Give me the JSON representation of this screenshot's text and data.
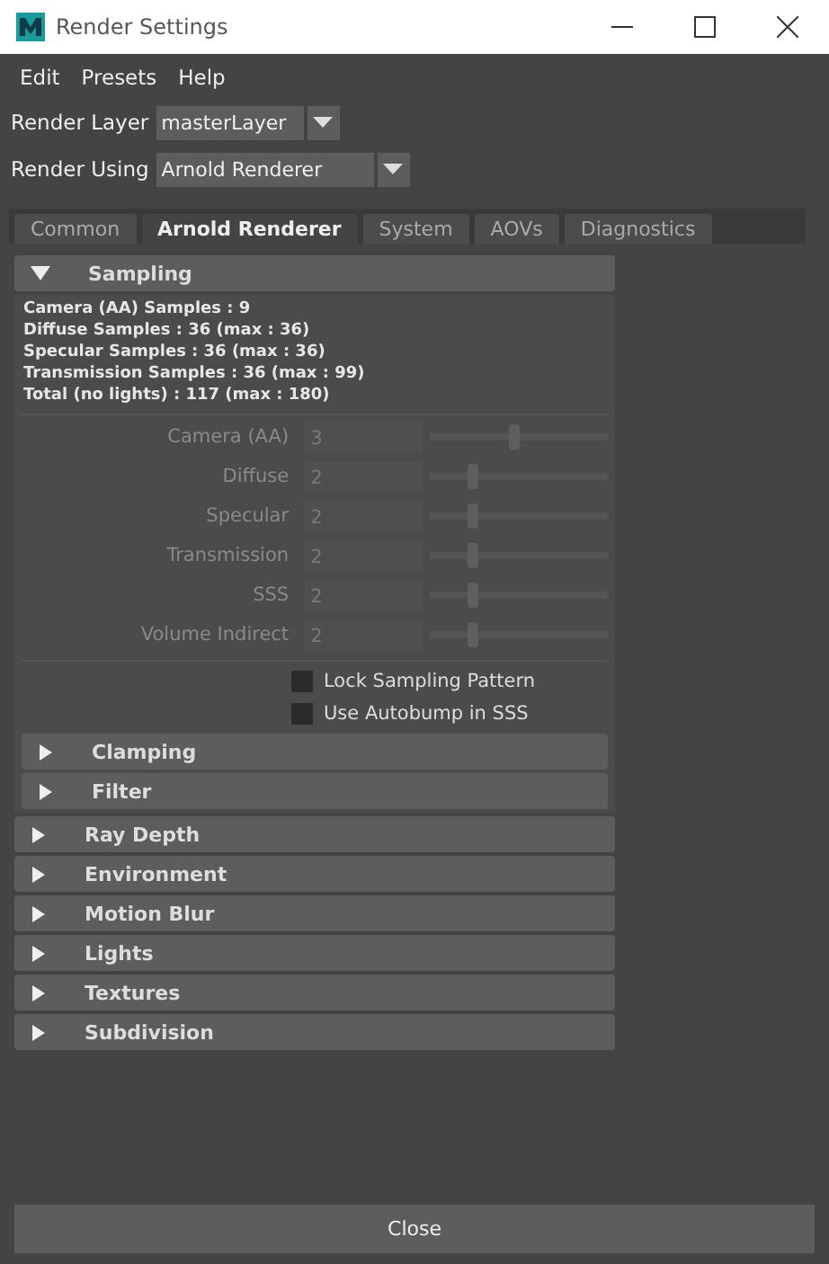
{
  "window": {
    "title": "Render Settings"
  },
  "menu": [
    "Edit",
    "Presets",
    "Help"
  ],
  "render_layer": {
    "label": "Render Layer",
    "value": "masterLayer"
  },
  "render_using": {
    "label": "Render Using",
    "value": "Arnold Renderer"
  },
  "tabs": [
    {
      "label": "Common",
      "selected": false
    },
    {
      "label": "Arnold Renderer",
      "selected": true
    },
    {
      "label": "System",
      "selected": false
    },
    {
      "label": "AOVs",
      "selected": false
    },
    {
      "label": "Diagnostics",
      "selected": false
    }
  ],
  "sampling": {
    "title": "Sampling",
    "expanded": true,
    "summary": [
      "Camera (AA) Samples : 9",
      "Diffuse Samples : 36 (max : 36)",
      "Specular Samples : 36 (max : 36)",
      "Transmission Samples : 36 (max : 99)",
      "Total (no lights) : 117 (max : 180)"
    ],
    "sliders": [
      {
        "label": "Camera (AA)",
        "value": "3",
        "level": 0.47,
        "disabled": true
      },
      {
        "label": "Diffuse",
        "value": "2",
        "level": 0.23,
        "disabled": true
      },
      {
        "label": "Specular",
        "value": "2",
        "level": 0.23,
        "disabled": true
      },
      {
        "label": "Transmission",
        "value": "2",
        "level": 0.23,
        "disabled": true
      },
      {
        "label": "SSS",
        "value": "2",
        "level": 0.23,
        "disabled": true
      },
      {
        "label": "Volume Indirect",
        "value": "2",
        "level": 0.23,
        "disabled": true
      }
    ],
    "checkboxes": [
      {
        "label": "Lock Sampling Pattern",
        "checked": false
      },
      {
        "label": "Use Autobump in SSS",
        "checked": false
      }
    ],
    "subsections": [
      {
        "title": "Clamping",
        "expanded": false
      },
      {
        "title": "Filter",
        "expanded": false
      }
    ]
  },
  "sections": [
    {
      "title": "Ray Depth",
      "expanded": false
    },
    {
      "title": "Environment",
      "expanded": false
    },
    {
      "title": "Motion Blur",
      "expanded": false
    },
    {
      "title": "Lights",
      "expanded": false
    },
    {
      "title": "Textures",
      "expanded": false
    },
    {
      "title": "Subdivision",
      "expanded": false
    }
  ],
  "close_button": "Close"
}
